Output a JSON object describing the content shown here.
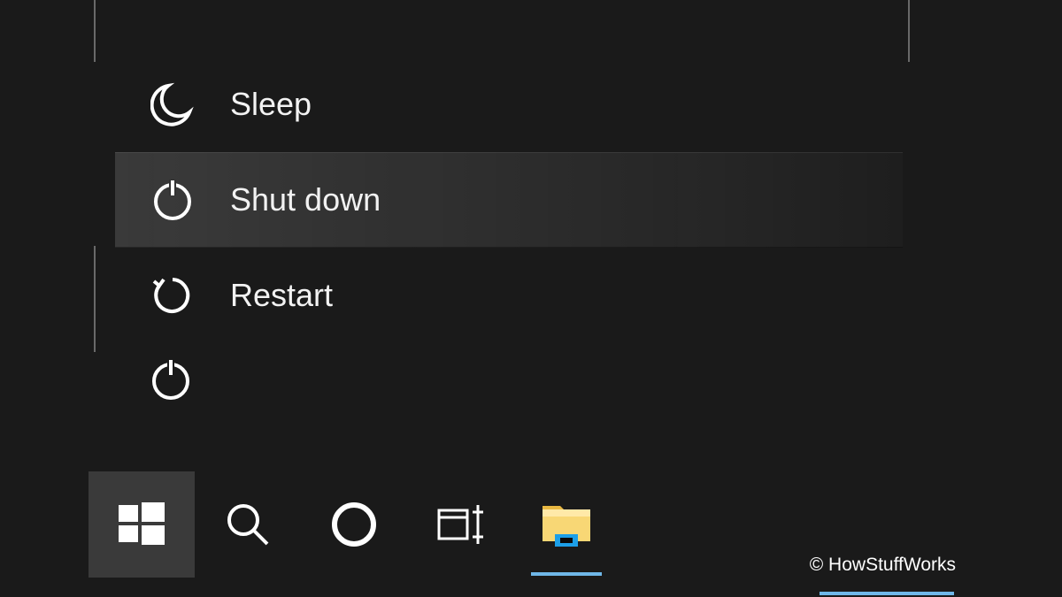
{
  "power_menu": {
    "sleep_label": "Sleep",
    "shutdown_label": "Shut down",
    "restart_label": "Restart"
  },
  "attribution": "© HowStuffWorks"
}
